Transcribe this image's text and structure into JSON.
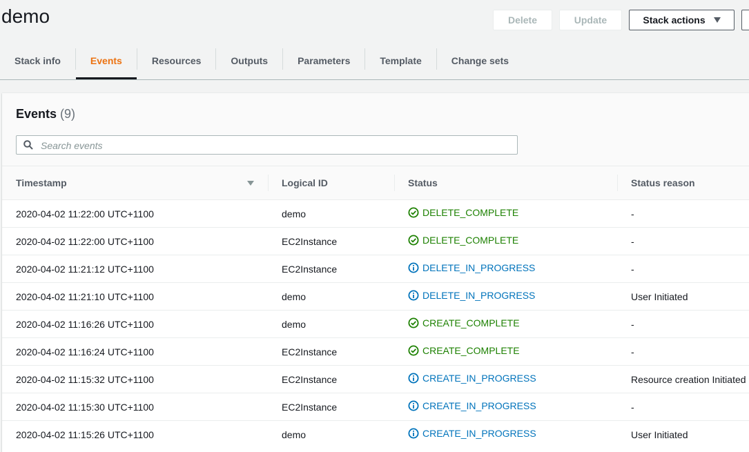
{
  "page": {
    "title": "demo"
  },
  "actions": {
    "delete_label": "Delete",
    "update_label": "Update",
    "stack_actions_label": "Stack actions"
  },
  "tabs": [
    {
      "label": "Stack info",
      "active": false
    },
    {
      "label": "Events",
      "active": true
    },
    {
      "label": "Resources",
      "active": false
    },
    {
      "label": "Outputs",
      "active": false
    },
    {
      "label": "Parameters",
      "active": false
    },
    {
      "label": "Template",
      "active": false
    },
    {
      "label": "Change sets",
      "active": false
    }
  ],
  "events": {
    "title": "Events",
    "count": "(9)",
    "search_placeholder": "Search events",
    "columns": {
      "timestamp": "Timestamp",
      "logical_id": "Logical ID",
      "status": "Status",
      "status_reason": "Status reason"
    },
    "rows": [
      {
        "timestamp": "2020-04-02 11:22:00 UTC+1100",
        "logical_id": "demo",
        "status": "DELETE_COMPLETE",
        "status_type": "success",
        "reason": "-"
      },
      {
        "timestamp": "2020-04-02 11:22:00 UTC+1100",
        "logical_id": "EC2Instance",
        "status": "DELETE_COMPLETE",
        "status_type": "success",
        "reason": "-"
      },
      {
        "timestamp": "2020-04-02 11:21:12 UTC+1100",
        "logical_id": "EC2Instance",
        "status": "DELETE_IN_PROGRESS",
        "status_type": "info",
        "reason": "-"
      },
      {
        "timestamp": "2020-04-02 11:21:10 UTC+1100",
        "logical_id": "demo",
        "status": "DELETE_IN_PROGRESS",
        "status_type": "info",
        "reason": "User Initiated"
      },
      {
        "timestamp": "2020-04-02 11:16:26 UTC+1100",
        "logical_id": "demo",
        "status": "CREATE_COMPLETE",
        "status_type": "success",
        "reason": "-"
      },
      {
        "timestamp": "2020-04-02 11:16:24 UTC+1100",
        "logical_id": "EC2Instance",
        "status": "CREATE_COMPLETE",
        "status_type": "success",
        "reason": "-"
      },
      {
        "timestamp": "2020-04-02 11:15:32 UTC+1100",
        "logical_id": "EC2Instance",
        "status": "CREATE_IN_PROGRESS",
        "status_type": "info",
        "reason": "Resource creation Initiated"
      },
      {
        "timestamp": "2020-04-02 11:15:30 UTC+1100",
        "logical_id": "EC2Instance",
        "status": "CREATE_IN_PROGRESS",
        "status_type": "info",
        "reason": "-"
      },
      {
        "timestamp": "2020-04-02 11:15:26 UTC+1100",
        "logical_id": "demo",
        "status": "CREATE_IN_PROGRESS",
        "status_type": "info",
        "reason": "User Initiated"
      }
    ]
  },
  "colors": {
    "active_tab": "#ec7211",
    "success": "#1d8102",
    "info": "#0073bb"
  }
}
